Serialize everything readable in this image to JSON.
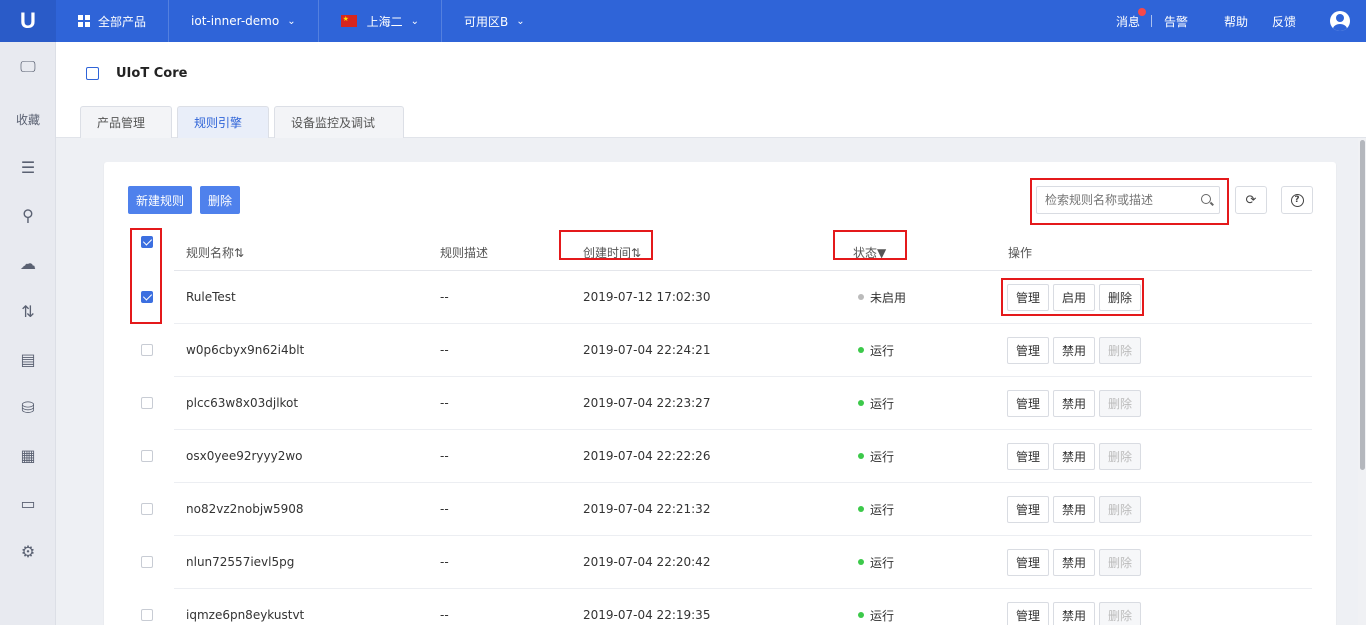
{
  "topbar": {
    "logo": "U",
    "all_products": "全部产品",
    "project": "iot-inner-demo",
    "region": "上海二",
    "zone": "可用区B",
    "links": [
      "消息",
      "告警",
      "帮助",
      "反馈"
    ]
  },
  "sidebar": {
    "favorites_label": "收藏"
  },
  "product": {
    "title": "UIoT Core"
  },
  "tabs": [
    "产品管理",
    "规则引擎",
    "设备监控及调试"
  ],
  "toolbar": {
    "new_rule": "新建规则",
    "delete": "删除",
    "search_placeholder": "检索规则名称或描述"
  },
  "table": {
    "columns": [
      "规则名称⇅",
      "规则描述",
      "创建时间⇅",
      "状态▼",
      "操作"
    ],
    "rows": [
      {
        "name": "RuleTest",
        "desc": "--",
        "created": "2019-07-12 17:02:30",
        "status": "未启用",
        "status_color": "#bbbbbb",
        "checked": true,
        "ops": [
          "管理",
          "启用",
          "删除"
        ],
        "delete_disabled": false
      },
      {
        "name": "w0p6cbyx9n62i4blt",
        "desc": "--",
        "created": "2019-07-04 22:24:21",
        "status": "运行",
        "status_color": "#3cc94a",
        "checked": false,
        "ops": [
          "管理",
          "禁用",
          "删除"
        ],
        "delete_disabled": true
      },
      {
        "name": "plcc63w8x03djlkot",
        "desc": "--",
        "created": "2019-07-04 22:23:27",
        "status": "运行",
        "status_color": "#3cc94a",
        "checked": false,
        "ops": [
          "管理",
          "禁用",
          "删除"
        ],
        "delete_disabled": true
      },
      {
        "name": "osx0yee92ryyy2wo",
        "desc": "--",
        "created": "2019-07-04 22:22:26",
        "status": "运行",
        "status_color": "#3cc94a",
        "checked": false,
        "ops": [
          "管理",
          "禁用",
          "删除"
        ],
        "delete_disabled": true
      },
      {
        "name": "no82vz2nobjw5908",
        "desc": "--",
        "created": "2019-07-04 22:21:32",
        "status": "运行",
        "status_color": "#3cc94a",
        "checked": false,
        "ops": [
          "管理",
          "禁用",
          "删除"
        ],
        "delete_disabled": true
      },
      {
        "name": "nlun72557ievl5pg",
        "desc": "--",
        "created": "2019-07-04 22:20:42",
        "status": "运行",
        "status_color": "#3cc94a",
        "checked": false,
        "ops": [
          "管理",
          "禁用",
          "删除"
        ],
        "delete_disabled": true
      },
      {
        "name": "iqmze6pn8eykustvt",
        "desc": "--",
        "created": "2019-07-04 22:19:35",
        "status": "运行",
        "status_color": "#3cc94a",
        "checked": false,
        "ops": [
          "管理",
          "禁用",
          "删除"
        ],
        "delete_disabled": true
      }
    ]
  },
  "colors": {
    "topbar": "#2f64d8",
    "primary_button": "#4f81ec",
    "highlight": "#e4191b",
    "running": "#3cc94a",
    "disabled": "#bbbbbb"
  }
}
